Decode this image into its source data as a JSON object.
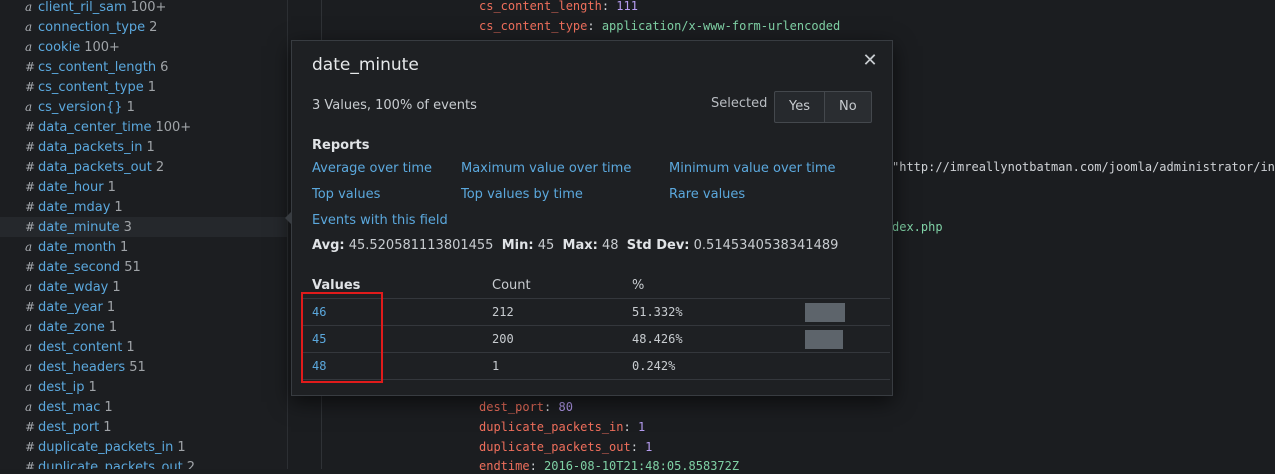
{
  "sidebar": {
    "fields": [
      {
        "type": "a",
        "name": "client_ril_sam",
        "count": "100+"
      },
      {
        "type": "a",
        "name": "connection_type",
        "count": "2"
      },
      {
        "type": "a",
        "name": "cookie",
        "count": "100+"
      },
      {
        "type": "#",
        "name": "cs_content_length",
        "count": "6"
      },
      {
        "type": "#",
        "name": "cs_content_type",
        "count": "1"
      },
      {
        "type": "a",
        "name": "cs_version{}",
        "count": "1"
      },
      {
        "type": "#",
        "name": "data_center_time",
        "count": "100+"
      },
      {
        "type": "#",
        "name": "data_packets_in",
        "count": "1"
      },
      {
        "type": "#",
        "name": "data_packets_out",
        "count": "2"
      },
      {
        "type": "#",
        "name": "date_hour",
        "count": "1"
      },
      {
        "type": "#",
        "name": "date_mday",
        "count": "1"
      },
      {
        "type": "#",
        "name": "date_minute",
        "count": "3"
      },
      {
        "type": "a",
        "name": "date_month",
        "count": "1"
      },
      {
        "type": "#",
        "name": "date_second",
        "count": "51"
      },
      {
        "type": "a",
        "name": "date_wday",
        "count": "1"
      },
      {
        "type": "#",
        "name": "date_year",
        "count": "1"
      },
      {
        "type": "a",
        "name": "date_zone",
        "count": "1"
      },
      {
        "type": "a",
        "name": "dest_content",
        "count": "1"
      },
      {
        "type": "a",
        "name": "dest_headers",
        "count": "51"
      },
      {
        "type": "a",
        "name": "dest_ip",
        "count": "1"
      },
      {
        "type": "a",
        "name": "dest_mac",
        "count": "1"
      },
      {
        "type": "#",
        "name": "dest_port",
        "count": "1"
      },
      {
        "type": "#",
        "name": "duplicate_packets_in",
        "count": "1"
      },
      {
        "type": "#",
        "name": "duplicate_packets_out",
        "count": "2"
      }
    ],
    "selected_field": "date_minute"
  },
  "events": {
    "lines_top": [
      {
        "key": "cs_content_length",
        "sep": ": ",
        "value": "111",
        "kind": "num"
      },
      {
        "key": "cs_content_type",
        "sep": ": ",
        "value": "application/x-www-form-urlencoded",
        "kind": "str"
      }
    ],
    "url_fragment": "\"http://imreallynotbatman.com/joomla/administrator/inde",
    "php_fragment": "dex.php",
    "lines_bottom": [
      {
        "key": "dest_port",
        "sep": ": ",
        "value": "80",
        "kind": "num"
      },
      {
        "key": "duplicate_packets_in",
        "sep": ": ",
        "value": "1",
        "kind": "num"
      },
      {
        "key": "duplicate_packets_out",
        "sep": ": ",
        "value": "1",
        "kind": "num"
      },
      {
        "key": "endtime",
        "sep": ": ",
        "value": "2016-08-10T21:48:05.858372Z",
        "kind": "str"
      }
    ]
  },
  "popup": {
    "title": "date_minute",
    "close_glyph": "✕",
    "summary": "3 Values, 100% of events",
    "selected_label": "Selected",
    "yes_label": "Yes",
    "no_label": "No",
    "reports_title": "Reports",
    "reports": [
      "Average over time",
      "Maximum value over time",
      "Minimum value over time",
      "Top values",
      "Top values by time",
      "Rare values",
      "Events with this field"
    ],
    "stats": {
      "avg_label": "Avg:",
      "avg": "45.520581113801455",
      "min_label": "Min:",
      "min": "45",
      "max_label": "Max:",
      "max": "48",
      "std_label": "Std Dev:",
      "std": "0.5145340538341489"
    },
    "table": {
      "headers": [
        "Values",
        "Count",
        "%"
      ],
      "rows": [
        {
          "value": "46",
          "count": "212",
          "pct": "51.332%",
          "fraction": 0.51332
        },
        {
          "value": "45",
          "count": "200",
          "pct": "48.426%",
          "fraction": 0.48426
        },
        {
          "value": "48",
          "count": "1",
          "pct": "0.242%",
          "fraction": 0.00242
        }
      ]
    }
  },
  "colors": {
    "link": "#5ba8dd",
    "key": "#ef6f5c",
    "number": "#b59cf0",
    "string": "#7fd1a5",
    "annotation": "#e01b1b"
  }
}
